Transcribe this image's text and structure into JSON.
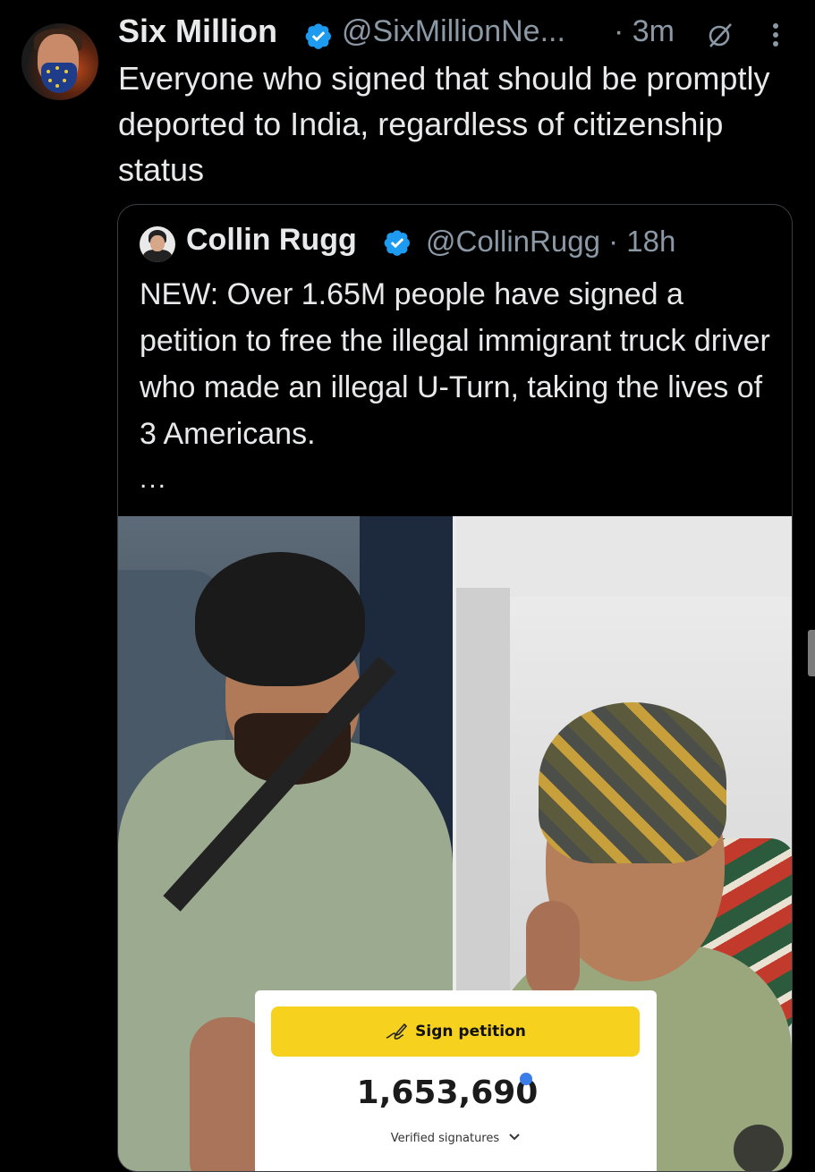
{
  "tweet": {
    "author_name": "Six Million",
    "author_handle": "@SixMillionNe...",
    "time": "· 3m",
    "text": "Everyone who signed that should be promptly deported to India, regardless of citizenship status"
  },
  "quote": {
    "author_name": "Collin Rugg",
    "author_handle": "@CollinRugg · 18h",
    "text": "NEW: Over 1.65M people have signed a petition to free the illegal immigrant truck driver who made an illegal U-Turn, taking the lives of 3 Americans.",
    "ellipsis": "...",
    "petition": {
      "button_label": "Sign petition",
      "count": "1,653,690",
      "count_label": "Verified signatures"
    }
  },
  "colors": {
    "background": "#000000",
    "text": "#e7e9ea",
    "muted": "#8b98a5",
    "verified": "#1d9bf0",
    "petition_yellow": "#f6d21f"
  },
  "icons": [
    "verified-badge-icon",
    "grok-icon",
    "more-options-icon",
    "signature-pen-icon",
    "chevron-down-icon",
    "verified-signature-icon"
  ]
}
